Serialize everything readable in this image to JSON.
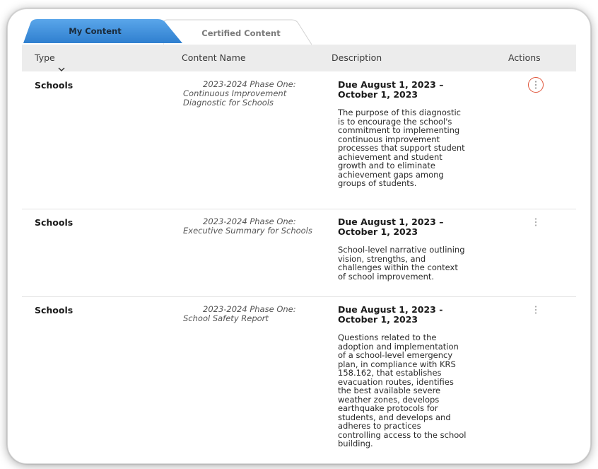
{
  "tabs": [
    {
      "label": "My Content",
      "active": true
    },
    {
      "label": "Certified Content",
      "active": false
    }
  ],
  "columns": {
    "type": "Type",
    "name": "Content Name",
    "description": "Description",
    "actions": "Actions"
  },
  "rows": [
    {
      "type": "Schools",
      "name_line1": "2023-2024 Phase One:",
      "name_line2": "Continuous Improvement Diagnostic for Schools",
      "due": "Due August 1, 2023 – October 1, 2023",
      "description": "The purpose of this diagnostic is to encourage the school's commitment to implementing continuous improvement processes that support student achievement and student growth and to eliminate achievement gaps among groups of students.",
      "actions_highlighted": true
    },
    {
      "type": "Schools",
      "name_line1": "2023-2024 Phase One:",
      "name_line2": "Executive Summary for Schools",
      "due": "Due August 1, 2023 – October 1, 2023",
      "description": "School-level narrative outlining vision, strengths, and challenges within the context of school improvement.",
      "actions_highlighted": false
    },
    {
      "type": "Schools",
      "name_line1": "2023-2024 Phase One:",
      "name_line2": "School Safety Report",
      "due": "Due August 1, 2023 - October 1, 2023",
      "description": "Questions related to the adoption and implementation of a school-level emergency plan, in compliance with KRS 158.162, that establishes evacuation routes, identifies the best available severe weather zones, develops earthquake protocols for students, and develops and adheres to practices controlling access to the school building.",
      "actions_highlighted": false
    }
  ],
  "icons": {
    "sort": "chevron-down-icon",
    "actions": "more-vertical-icon"
  },
  "colors": {
    "active_tab": "#3f8fd8",
    "header_bg": "#ececec",
    "action_highlight": "#e0553a"
  }
}
